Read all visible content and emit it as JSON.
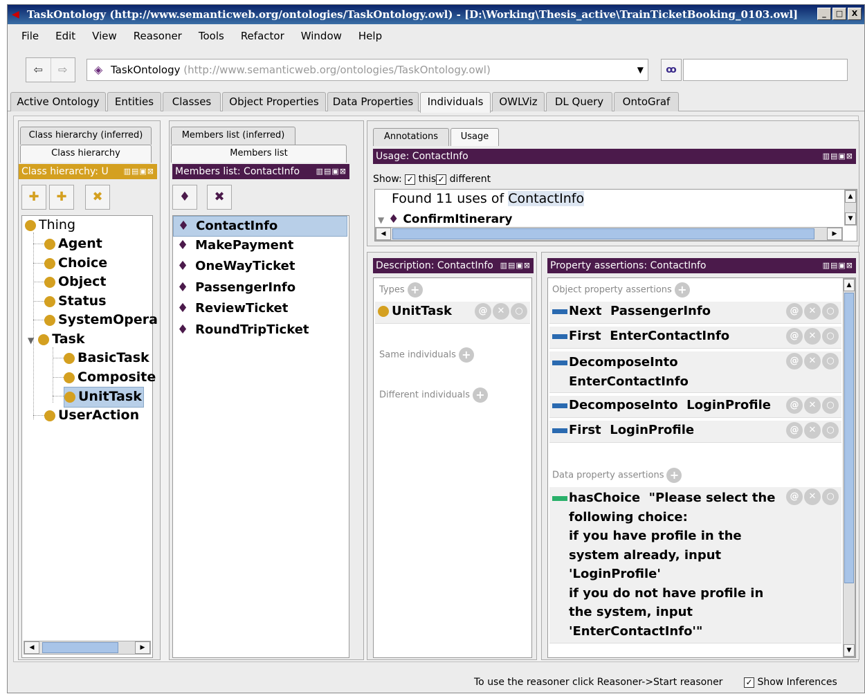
{
  "window": {
    "title": "TaskOntology (http://www.semanticweb.org/ontologies/TaskOntology.owl) - [D:\\Working\\Thesis_active\\TrainTicketBooking_0103.owl]",
    "controls": [
      "_",
      "□",
      "X"
    ]
  },
  "menu": [
    "File",
    "Edit",
    "View",
    "Reasoner",
    "Tools",
    "Refactor",
    "Window",
    "Help"
  ],
  "toolbar": {
    "back_icon": "arrow-left-icon",
    "forward_icon": "arrow-right-icon",
    "ontology_name": "TaskOntology",
    "ontology_url": "(http://www.semanticweb.org/ontologies/TaskOntology.owl)",
    "search_value": ""
  },
  "tabs": [
    "Active Ontology",
    "Entities",
    "Classes",
    "Object Properties",
    "Data Properties",
    "Individuals",
    "OWLViz",
    "DL Query",
    "OntoGraf"
  ],
  "active_tab": "Individuals",
  "class_panel": {
    "subtabs": [
      "Class hierarchy (inferred)",
      "Class hierarchy"
    ],
    "header": "Class hierarchy: U",
    "tree": [
      {
        "label": "Thing",
        "level": 0
      },
      {
        "label": "Agent",
        "level": 1
      },
      {
        "label": "Choice",
        "level": 1
      },
      {
        "label": "Object",
        "level": 1
      },
      {
        "label": "Status",
        "level": 1
      },
      {
        "label": "SystemOpera",
        "level": 1
      },
      {
        "label": "Task",
        "level": 1
      },
      {
        "label": "BasicTask",
        "level": 2
      },
      {
        "label": "Composite",
        "level": 2
      },
      {
        "label": "UnitTask",
        "level": 2
      },
      {
        "label": "UserAction",
        "level": 1
      }
    ],
    "selected": "UnitTask"
  },
  "members_panel": {
    "subtabs": [
      "Members list (inferred)",
      "Members list"
    ],
    "header": "Members list: ContactInfo",
    "members": [
      "ContactInfo",
      "MakePayment",
      "OneWayTicket",
      "PassengerInfo",
      "ReviewTicket",
      "RoundTripTicket"
    ],
    "selected": "ContactInfo"
  },
  "usage_panel": {
    "subtabs": [
      "Annotations",
      "Usage"
    ],
    "header": "Usage: ContactInfo",
    "show_label": "Show:",
    "this_label": "this",
    "different_label": "different",
    "found_prefix": "Found 11 uses of ",
    "found_entity": "ContactInfo",
    "first_use": "ConfirmItinerary"
  },
  "description_panel": {
    "header": "Description: ContactInfo",
    "types_label": "Types",
    "type_value": "UnitTask",
    "same_label": "Same individuals",
    "different_label": "Different individuals"
  },
  "property_panel": {
    "header": "Property assertions: ContactInfo",
    "object_label": "Object property assertions",
    "object_assertions": [
      {
        "prop": "Next",
        "value": "PassengerInfo"
      },
      {
        "prop": "First",
        "value": "EnterContactInfo"
      },
      {
        "prop": "DecomposeInto",
        "value": "EnterContactInfo"
      },
      {
        "prop": "DecomposeInto",
        "value": "LoginProfile"
      },
      {
        "prop": "First",
        "value": "LoginProfile"
      }
    ],
    "data_label": "Data property assertions",
    "data_assertion": {
      "prop": "hasChoice",
      "lines": [
        "\"Please select the",
        "following choice:",
        "if you have profile in the",
        "system already, input",
        "'LoginProfile'",
        "if you do not have profile in",
        "the system, input",
        "'EnterContactInfo'\""
      ]
    }
  },
  "status": {
    "message": "To use the reasoner click Reasoner->Start reasoner",
    "show_inferences": "Show Inferences"
  },
  "colors": {
    "view_header": "#4b1a4b",
    "class_header": "#d4a020",
    "selection": "#b8cfe8"
  }
}
